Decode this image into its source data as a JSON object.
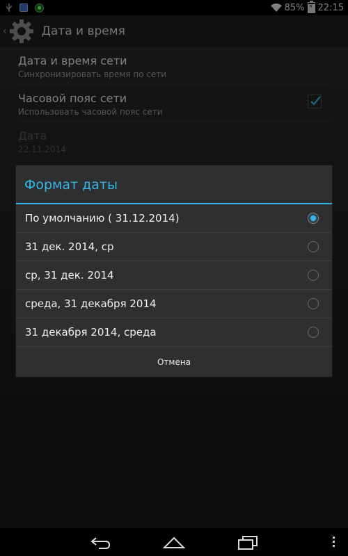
{
  "status_bar": {
    "battery_percent": "85%",
    "time": "22:15",
    "battery_level": 0.85,
    "icons": [
      "usb-icon",
      "notification-box-icon",
      "avast-icon",
      "wifi-icon",
      "battery-icon"
    ]
  },
  "action_bar": {
    "title": "Дата и время"
  },
  "settings": {
    "items": [
      {
        "title": "Дата и время сети",
        "subtitle": "Синхронизировать время по сети"
      },
      {
        "title": "Часовой пояс сети",
        "subtitle": "Использовать часовой пояс сети",
        "checked": true
      },
      {
        "title": "Дата",
        "subtitle": "22.11.2014",
        "disabled": true
      }
    ]
  },
  "dialog": {
    "title": "Формат даты",
    "options": [
      {
        "label": "По умолчанию ( 31.12.2014)",
        "selected": true
      },
      {
        "label": "31 дек. 2014, ср",
        "selected": false
      },
      {
        "label": "ср, 31 дек. 2014",
        "selected": false
      },
      {
        "label": "среда, 31 декабря 2014",
        "selected": false
      },
      {
        "label": "31 декабря 2014, среда",
        "selected": false
      }
    ],
    "cancel_label": "Отмена"
  },
  "colors": {
    "accent": "#33b5e5",
    "dialog_bg": "#2e2f31",
    "background": "#000000"
  }
}
